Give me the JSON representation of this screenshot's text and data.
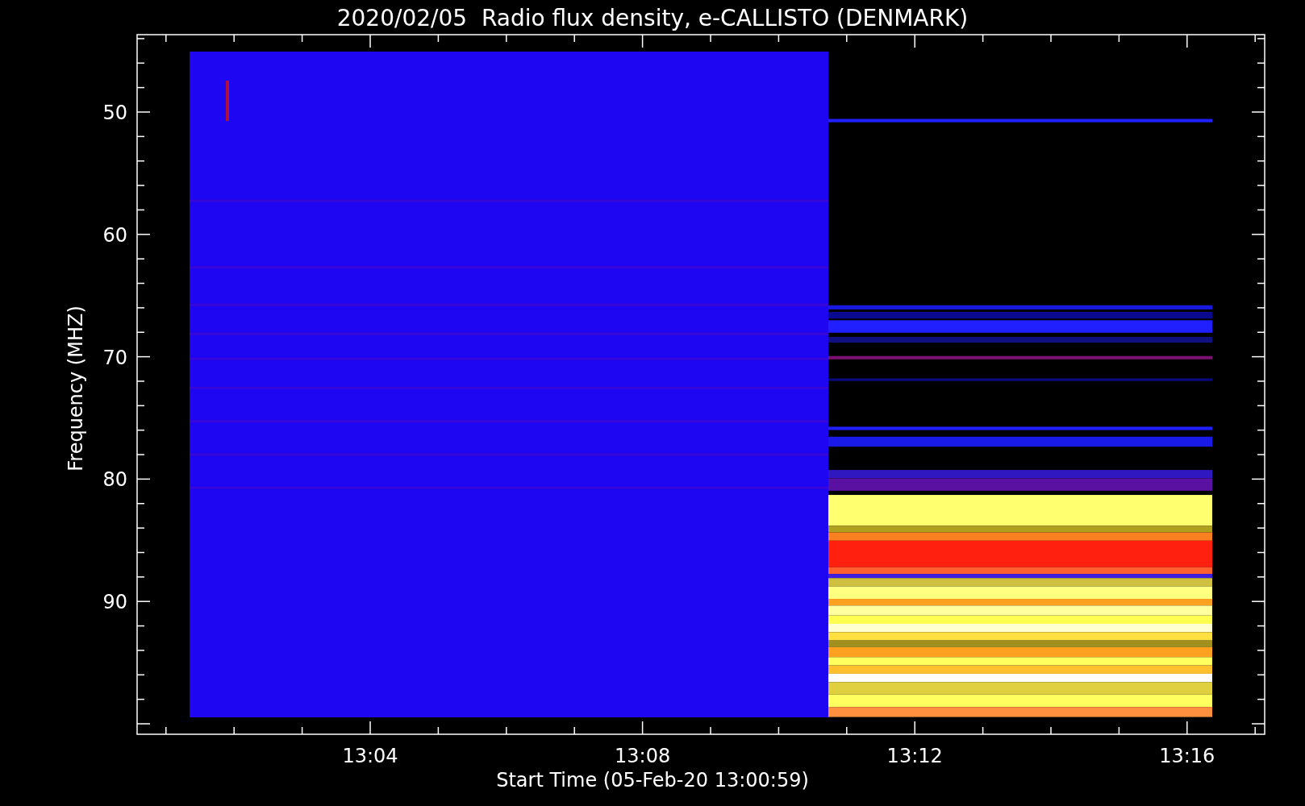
{
  "title": "2020/02/05  Radio flux density, e-CALLISTO (DENMARK)",
  "y_axis": {
    "label": "Frequency (MHZ)",
    "ticks": [
      "50",
      "60",
      "70",
      "80",
      "90"
    ]
  },
  "x_axis": {
    "label": "Start Time (05-Feb-20 13:00:59)",
    "ticks": [
      "13:04",
      "13:08",
      "13:12",
      "13:16"
    ]
  }
}
